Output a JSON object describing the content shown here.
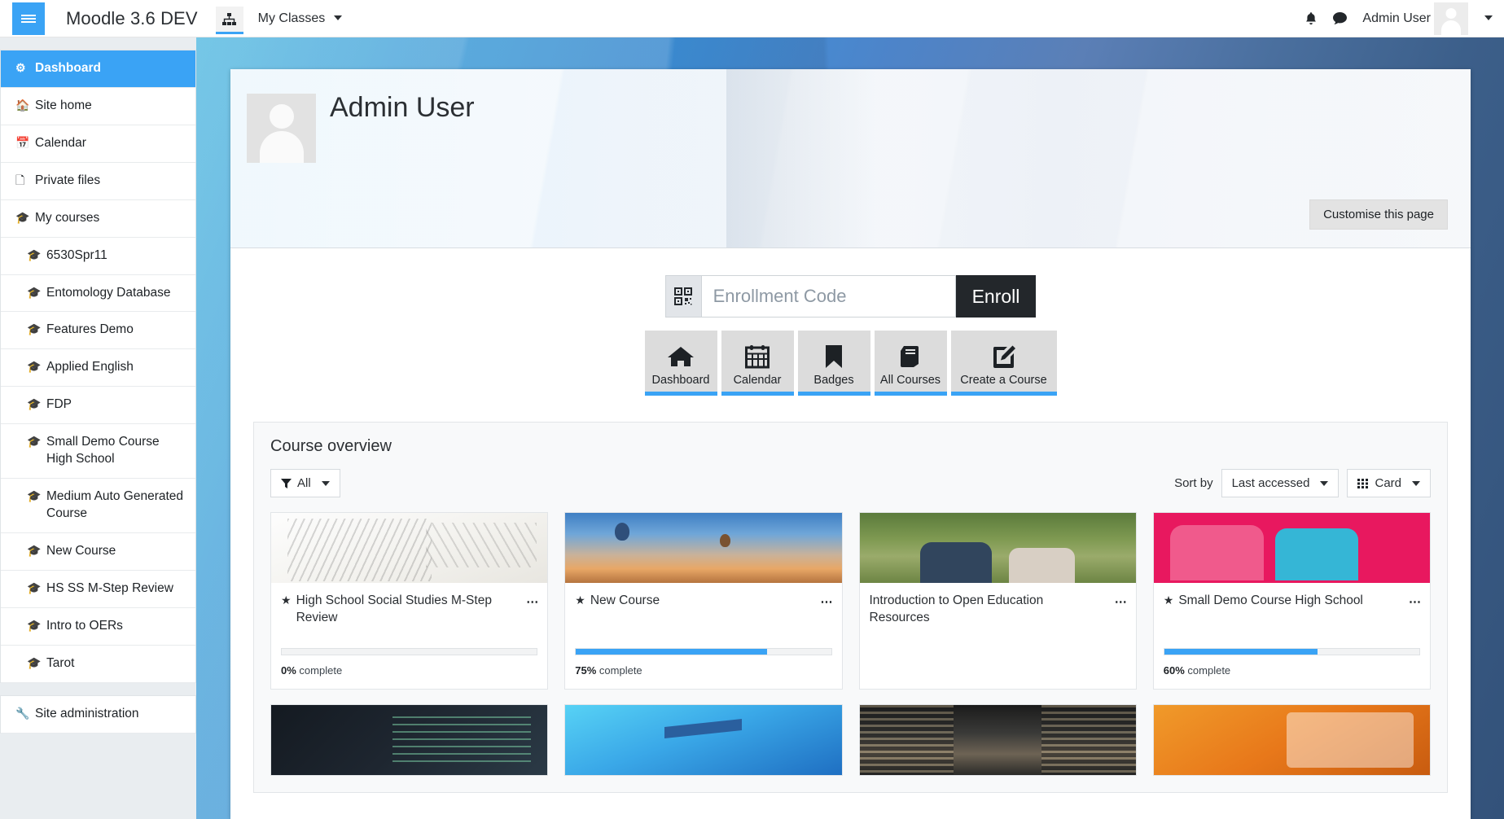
{
  "navbar": {
    "brand": "Moodle 3.6 DEV",
    "myclasses_label": "My Classes",
    "username": "Admin User"
  },
  "sidebar": {
    "primary": [
      {
        "label": "Dashboard",
        "icon": "dashboard-icon",
        "active": true
      },
      {
        "label": "Site home",
        "icon": "home-icon",
        "active": false
      },
      {
        "label": "Calendar",
        "icon": "calendar-icon",
        "active": false
      },
      {
        "label": "Private files",
        "icon": "file-icon",
        "active": false
      },
      {
        "label": "My courses",
        "icon": "graduation-cap-icon",
        "active": false
      }
    ],
    "courses": [
      {
        "label": "6530Spr11"
      },
      {
        "label": "Entomology Database"
      },
      {
        "label": "Features Demo"
      },
      {
        "label": "Applied English"
      },
      {
        "label": "FDP"
      },
      {
        "label": "Small Demo Course High School"
      },
      {
        "label": "Medium Auto Generated Course"
      },
      {
        "label": "New Course"
      },
      {
        "label": "HS SS M-Step Review"
      },
      {
        "label": "Intro to OERs"
      },
      {
        "label": "Tarot"
      }
    ],
    "admin": {
      "label": "Site administration",
      "icon": "wrench-icon"
    }
  },
  "profile": {
    "name": "Admin User",
    "customise_label": "Customise this page"
  },
  "enroll": {
    "placeholder": "Enrollment Code",
    "value": "",
    "button_label": "Enroll",
    "icon": "qr-code-icon"
  },
  "tiles": [
    {
      "label": "Dashboard",
      "icon": "home-icon"
    },
    {
      "label": "Calendar",
      "icon": "calendar-icon"
    },
    {
      "label": "Badges",
      "icon": "bookmark-icon"
    },
    {
      "label": "All Courses",
      "icon": "book-icon"
    },
    {
      "label": "Create a Course",
      "icon": "edit-pencil-icon"
    }
  ],
  "overview": {
    "title": "Course overview",
    "filter_label": "All",
    "sortby_label": "Sort by",
    "sort_value": "Last accessed",
    "view_value": "Card",
    "courses": [
      {
        "title": "High School Social Studies M-Step Review",
        "starred": true,
        "progress": 0,
        "progress_text": "complete",
        "progress_pct": "0%",
        "art": "img-notes",
        "has_progress": true
      },
      {
        "title": "New Course",
        "starred": true,
        "progress": 75,
        "progress_text": "complete",
        "progress_pct": "75%",
        "art": "img-balloon",
        "has_progress": true
      },
      {
        "title": "Introduction to Open Education Resources",
        "starred": false,
        "progress": null,
        "progress_text": "",
        "progress_pct": "",
        "art": "img-students",
        "has_progress": false
      },
      {
        "title": "Small Demo Course High School",
        "starred": true,
        "progress": 60,
        "progress_text": "complete",
        "progress_pct": "60%",
        "art": "img-kids",
        "has_progress": true
      }
    ],
    "courses_row2_art": [
      "img-code",
      "img-cap",
      "img-library",
      "img-writing"
    ]
  },
  "colors": {
    "accent": "#3aa3f5",
    "enroll_button": "#23272b",
    "sidebar_bg": "#e9edf0"
  }
}
